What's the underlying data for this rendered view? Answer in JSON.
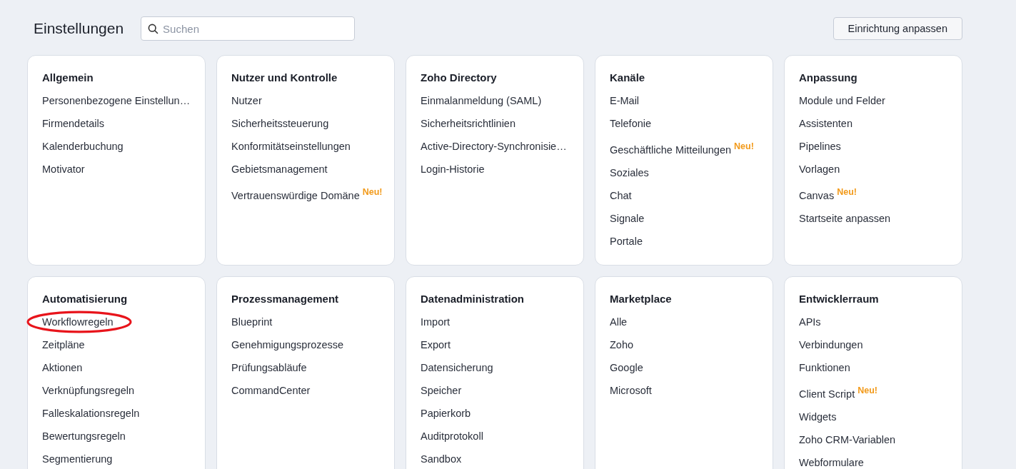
{
  "header": {
    "title": "Einstellungen",
    "search": {
      "placeholder": "Suchen"
    },
    "customize_button": "Einrichtung anpassen"
  },
  "cards": [
    {
      "title": "Allgemein",
      "items": [
        {
          "label": "Personenbezogene Einstellun…"
        },
        {
          "label": "Firmendetails"
        },
        {
          "label": "Kalenderbuchung"
        },
        {
          "label": "Motivator"
        }
      ]
    },
    {
      "title": "Nutzer und Kontrolle",
      "items": [
        {
          "label": "Nutzer"
        },
        {
          "label": "Sicherheitssteuerung"
        },
        {
          "label": "Konformitätseinstellungen"
        },
        {
          "label": "Gebietsmanagement"
        },
        {
          "label": "Vertrauenswürdige Domäne",
          "badge": "Neu!"
        }
      ]
    },
    {
      "title": "Zoho Directory",
      "items": [
        {
          "label": "Einmalanmeldung (SAML)"
        },
        {
          "label": "Sicherheitsrichtlinien"
        },
        {
          "label": "Active-Directory-Synchronisie…"
        },
        {
          "label": "Login-Historie"
        }
      ]
    },
    {
      "title": "Kanäle",
      "items": [
        {
          "label": "E-Mail"
        },
        {
          "label": "Telefonie"
        },
        {
          "label": "Geschäftliche Mitteilungen",
          "badge": "Neu!"
        },
        {
          "label": "Soziales"
        },
        {
          "label": "Chat"
        },
        {
          "label": "Signale"
        },
        {
          "label": "Portale"
        }
      ]
    },
    {
      "title": "Anpassung",
      "items": [
        {
          "label": "Module und Felder"
        },
        {
          "label": "Assistenten"
        },
        {
          "label": "Pipelines"
        },
        {
          "label": "Vorlagen"
        },
        {
          "label": "Canvas",
          "badge": "Neu!"
        },
        {
          "label": "Startseite anpassen"
        }
      ]
    },
    {
      "title": "Automatisierung",
      "items": [
        {
          "label": "Workflowregeln",
          "highlighted": true
        },
        {
          "label": "Zeitpläne"
        },
        {
          "label": "Aktionen"
        },
        {
          "label": "Verknüpfungsregeln"
        },
        {
          "label": "Falleskalationsregeln"
        },
        {
          "label": "Bewertungsregeln"
        },
        {
          "label": "Segmentierung"
        }
      ]
    },
    {
      "title": "Prozessmanagement",
      "items": [
        {
          "label": "Blueprint"
        },
        {
          "label": "Genehmigungsprozesse"
        },
        {
          "label": "Prüfungsabläufe"
        },
        {
          "label": "CommandCenter"
        }
      ]
    },
    {
      "title": "Datenadministration",
      "items": [
        {
          "label": "Import"
        },
        {
          "label": "Export"
        },
        {
          "label": "Datensicherung"
        },
        {
          "label": "Speicher"
        },
        {
          "label": "Papierkorb"
        },
        {
          "label": "Auditprotokoll"
        },
        {
          "label": "Sandbox"
        }
      ]
    },
    {
      "title": "Marketplace",
      "items": [
        {
          "label": "Alle"
        },
        {
          "label": "Zoho"
        },
        {
          "label": "Google"
        },
        {
          "label": "Microsoft"
        }
      ]
    },
    {
      "title": "Entwicklerraum",
      "items": [
        {
          "label": "APIs"
        },
        {
          "label": "Verbindungen"
        },
        {
          "label": "Funktionen"
        },
        {
          "label": "Client Script",
          "badge": "Neu!"
        },
        {
          "label": "Widgets"
        },
        {
          "label": "Zoho CRM-Variablen"
        },
        {
          "label": "Webformulare"
        }
      ]
    }
  ]
}
